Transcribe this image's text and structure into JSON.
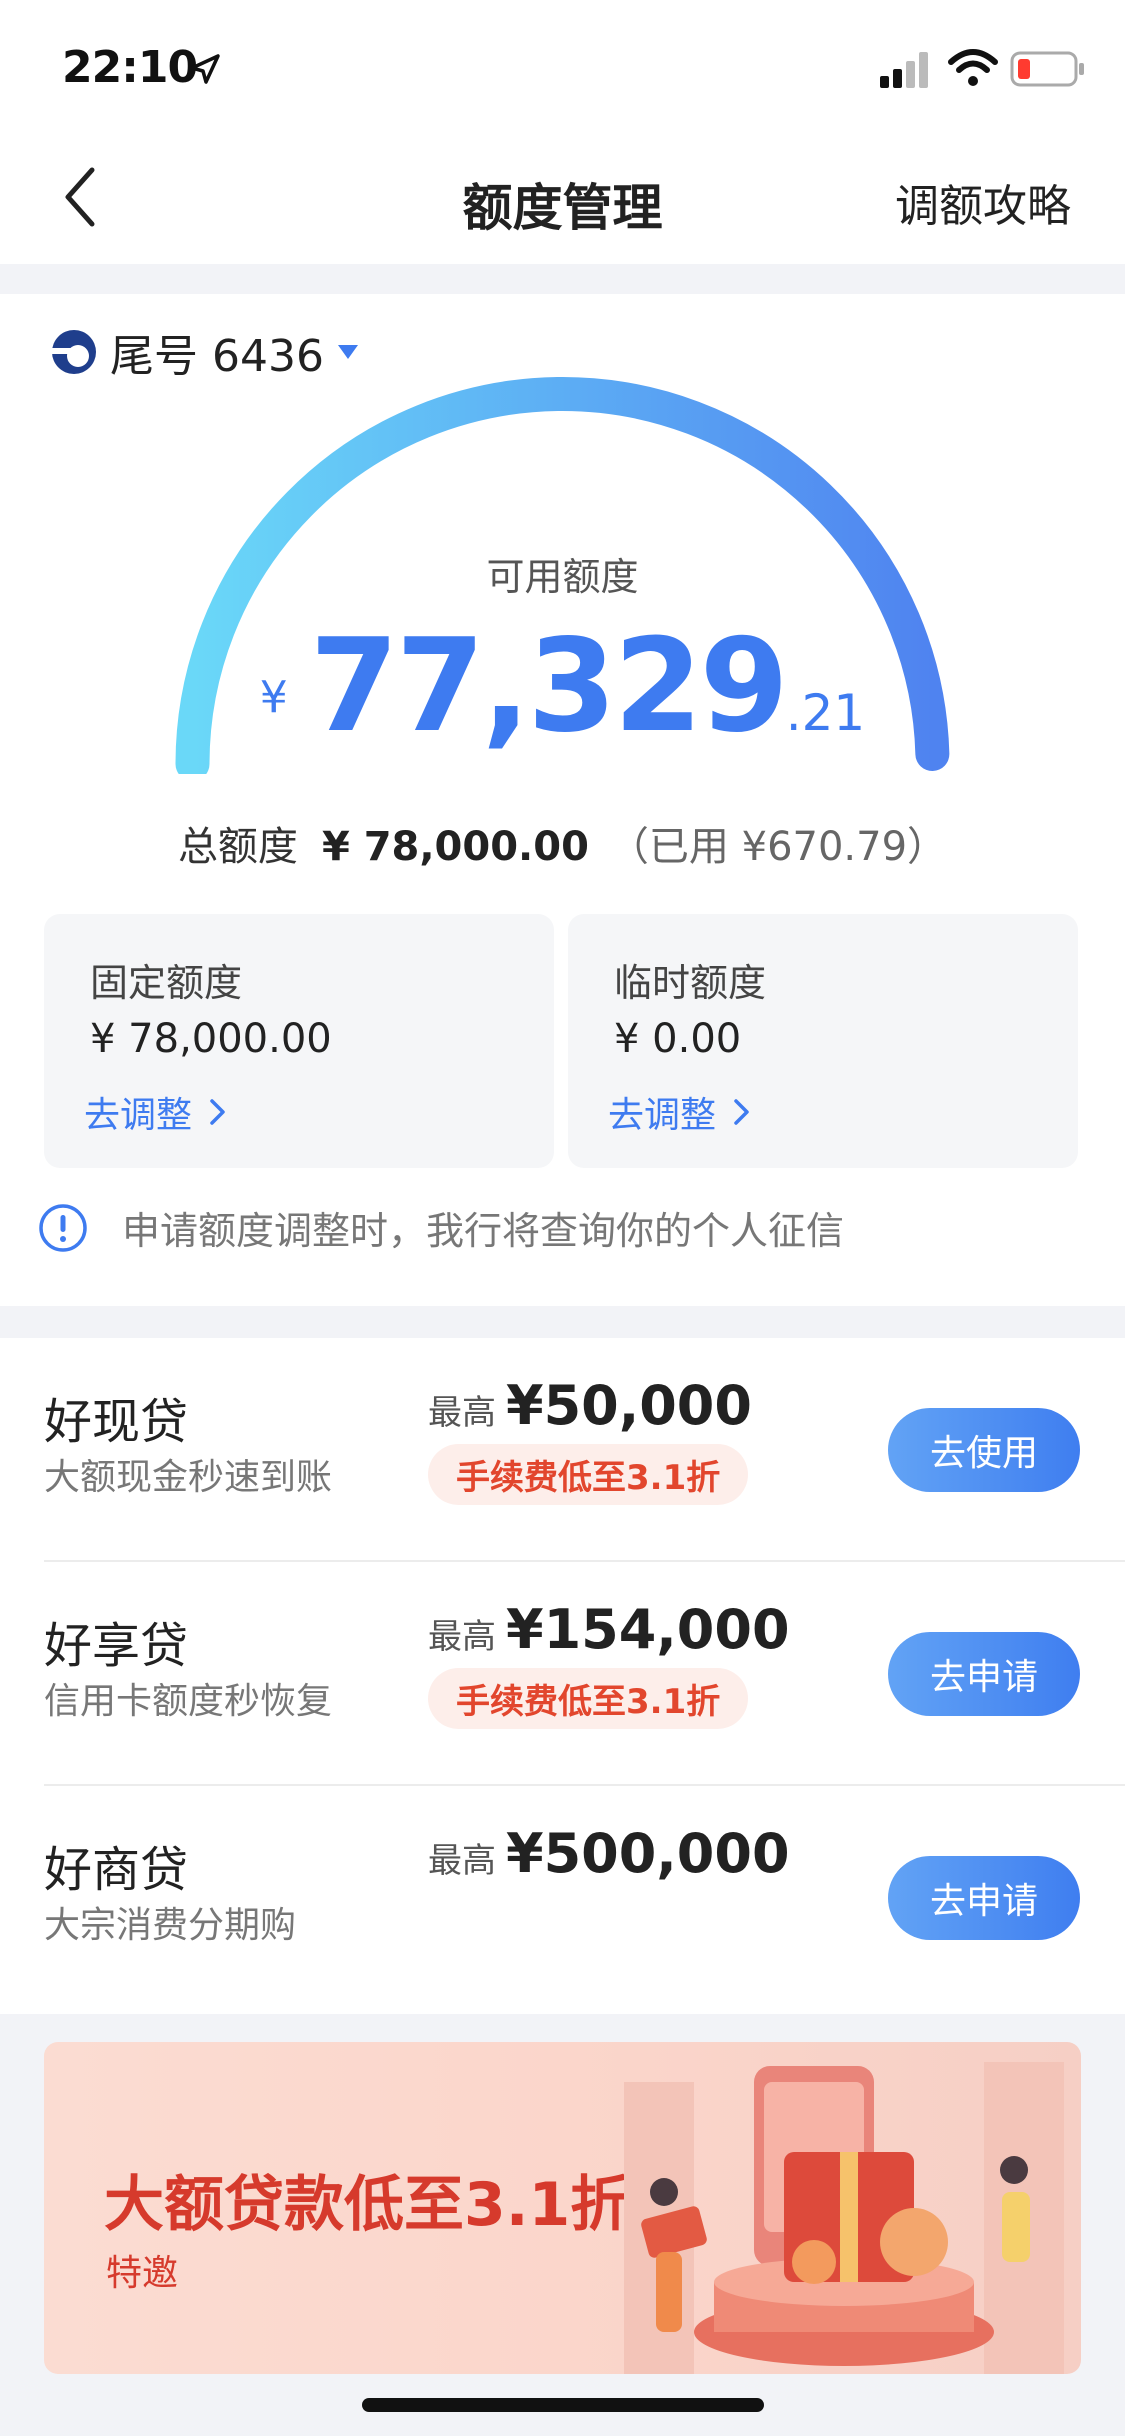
{
  "status_bar": {
    "time": "22:10"
  },
  "nav": {
    "title": "额度管理",
    "action": "调额攻略"
  },
  "card": {
    "tail": "尾号 6436"
  },
  "available": {
    "label": "可用额度",
    "currency": "¥",
    "integer": "77,329",
    "decimal": ".21"
  },
  "total": {
    "label": "总额度",
    "value": "¥ 78,000.00",
    "used": "（已用 ¥670.79）"
  },
  "fixed": {
    "title": "固定额度",
    "value": "¥ 78,000.00",
    "link": "去调整"
  },
  "temporary": {
    "title": "临时额度",
    "value": "¥ 0.00",
    "link": "去调整"
  },
  "notice": "申请额度调整时，我行将查询你的个人征信",
  "loans": [
    {
      "name": "好现贷",
      "desc": "大额现金秒速到账",
      "max_label": "最高",
      "max_value": "¥50,000",
      "tag": "手续费低至3.1折",
      "button": "去使用"
    },
    {
      "name": "好享贷",
      "desc": "信用卡额度秒恢复",
      "max_label": "最高",
      "max_value": "¥154,000",
      "tag": "手续费低至3.1折",
      "button": "去申请"
    },
    {
      "name": "好商贷",
      "desc": "大宗消费分期购",
      "max_label": "最高",
      "max_value": "¥500,000",
      "button": "去申请"
    }
  ],
  "banner": {
    "title": "大额贷款低至3.1折",
    "subtitle": "特邀"
  },
  "colors": {
    "accent": "#3e7bf0",
    "gauge_start": "#6ad8f8",
    "gauge_end": "#4f83f0",
    "promo_red": "#d63a2c"
  },
  "available_ratio": 0.9914
}
